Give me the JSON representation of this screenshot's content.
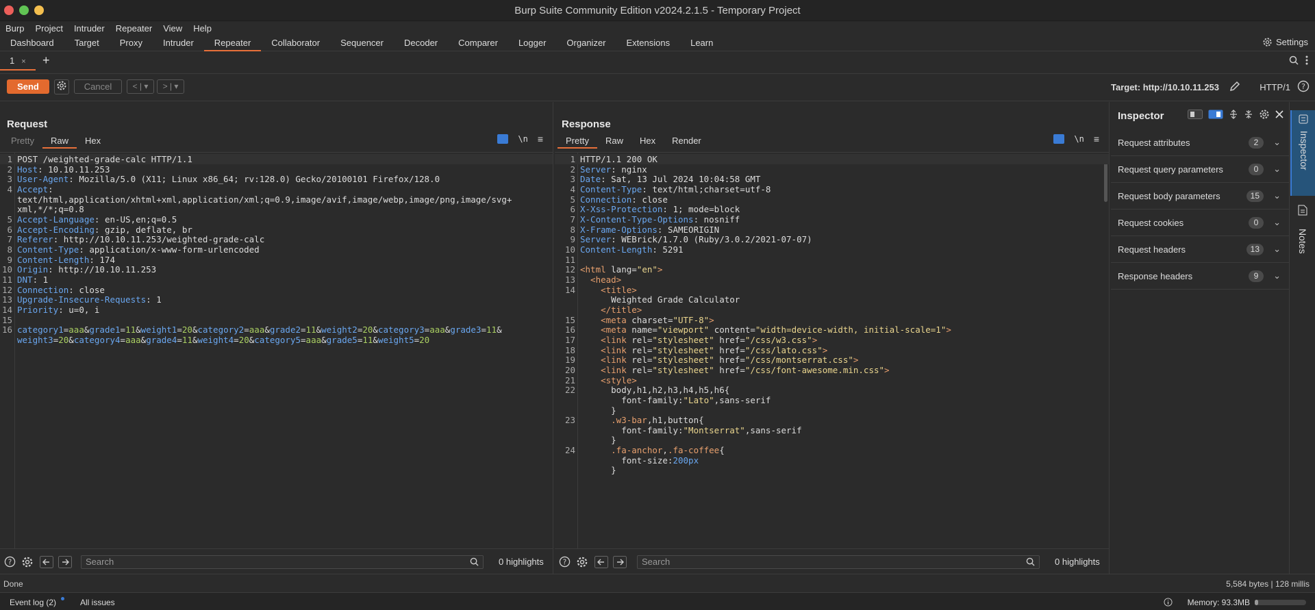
{
  "window": {
    "title": "Burp Suite Community Edition v2024.2.1.5 - Temporary Project"
  },
  "menu": [
    "Burp",
    "Project",
    "Intruder",
    "Repeater",
    "View",
    "Help"
  ],
  "nav_tabs": [
    "Dashboard",
    "Target",
    "Proxy",
    "Intruder",
    "Repeater",
    "Collaborator",
    "Sequencer",
    "Decoder",
    "Comparer",
    "Logger",
    "Organizer",
    "Extensions",
    "Learn"
  ],
  "nav_active": "Repeater",
  "settings_label": "Settings",
  "repeater_tab": {
    "label": "1",
    "close": "×",
    "plus": "+"
  },
  "toolbar": {
    "send": "Send",
    "cancel": "Cancel",
    "prev": "<",
    "next": ">",
    "dropdown": "▾",
    "target": "Target: http://10.10.11.253",
    "http": "HTTP/1"
  },
  "request": {
    "title": "Request",
    "tabs": [
      "Pretty",
      "Raw",
      "Hex"
    ],
    "active_tab": "Raw",
    "lines": [
      {
        "n": "1",
        "parts": [
          [
            "",
            "POST /weighted-grade-calc HTTP/1.1"
          ]
        ]
      },
      {
        "n": "2",
        "parts": [
          [
            "k",
            "Host"
          ],
          [
            "",
            ": 10.10.11.253"
          ]
        ]
      },
      {
        "n": "3",
        "parts": [
          [
            "k",
            "User-Agent"
          ],
          [
            "",
            ": Mozilla/5.0 (X11; Linux x86_64; rv:128.0) Gecko/20100101 Firefox/128.0"
          ]
        ]
      },
      {
        "n": "4",
        "parts": [
          [
            "k",
            "Accept"
          ],
          [
            "",
            ":"
          ]
        ]
      },
      {
        "n": "",
        "parts": [
          [
            "",
            "text/html,application/xhtml+xml,application/xml;q=0.9,image/avif,image/webp,image/png,image/svg+"
          ]
        ]
      },
      {
        "n": "",
        "parts": [
          [
            "",
            "xml,*/*;q=0.8"
          ]
        ]
      },
      {
        "n": "5",
        "parts": [
          [
            "k",
            "Accept-Language"
          ],
          [
            "",
            ": en-US,en;q=0.5"
          ]
        ]
      },
      {
        "n": "6",
        "parts": [
          [
            "k",
            "Accept-Encoding"
          ],
          [
            "",
            ": gzip, deflate, br"
          ]
        ]
      },
      {
        "n": "7",
        "parts": [
          [
            "k",
            "Referer"
          ],
          [
            "",
            ": http://10.10.11.253/weighted-grade-calc"
          ]
        ]
      },
      {
        "n": "8",
        "parts": [
          [
            "k",
            "Content-Type"
          ],
          [
            "",
            ": application/x-www-form-urlencoded"
          ]
        ]
      },
      {
        "n": "9",
        "parts": [
          [
            "k",
            "Content-Length"
          ],
          [
            "",
            ": 174"
          ]
        ]
      },
      {
        "n": "10",
        "parts": [
          [
            "k",
            "Origin"
          ],
          [
            "",
            ": http://10.10.11.253"
          ]
        ]
      },
      {
        "n": "11",
        "parts": [
          [
            "k",
            "DNT"
          ],
          [
            "",
            ": 1"
          ]
        ]
      },
      {
        "n": "12",
        "parts": [
          [
            "k",
            "Connection"
          ],
          [
            "",
            ": close"
          ]
        ]
      },
      {
        "n": "13",
        "parts": [
          [
            "k",
            "Upgrade-Insecure-Requests"
          ],
          [
            "",
            ": 1"
          ]
        ]
      },
      {
        "n": "14",
        "parts": [
          [
            "k",
            "Priority"
          ],
          [
            "",
            ": u=0, i"
          ]
        ]
      },
      {
        "n": "15",
        "parts": [
          [
            "",
            ""
          ]
        ]
      },
      {
        "n": "16",
        "parts": [
          [
            "k",
            "category1"
          ],
          [
            "",
            "="
          ],
          [
            "v",
            "aaa"
          ],
          [
            "",
            "&"
          ],
          [
            "k",
            "grade1"
          ],
          [
            "",
            "="
          ],
          [
            "v",
            "11"
          ],
          [
            "",
            "&"
          ],
          [
            "k",
            "weight1"
          ],
          [
            "",
            "="
          ],
          [
            "v",
            "20"
          ],
          [
            "",
            "&"
          ],
          [
            "k",
            "category2"
          ],
          [
            "",
            "="
          ],
          [
            "v",
            "aaa"
          ],
          [
            "",
            "&"
          ],
          [
            "k",
            "grade2"
          ],
          [
            "",
            "="
          ],
          [
            "v",
            "11"
          ],
          [
            "",
            "&"
          ],
          [
            "k",
            "weight2"
          ],
          [
            "",
            "="
          ],
          [
            "v",
            "20"
          ],
          [
            "",
            "&"
          ],
          [
            "k",
            "category3"
          ],
          [
            "",
            "="
          ],
          [
            "v",
            "aaa"
          ],
          [
            "",
            "&"
          ],
          [
            "k",
            "grade3"
          ],
          [
            "",
            "="
          ],
          [
            "v",
            "11"
          ],
          [
            "",
            "&"
          ]
        ]
      },
      {
        "n": "",
        "parts": [
          [
            "k",
            "weight3"
          ],
          [
            "",
            "="
          ],
          [
            "v",
            "20"
          ],
          [
            "",
            "&"
          ],
          [
            "k",
            "category4"
          ],
          [
            "",
            "="
          ],
          [
            "v",
            "aaa"
          ],
          [
            "",
            "&"
          ],
          [
            "k",
            "grade4"
          ],
          [
            "",
            "="
          ],
          [
            "v",
            "11"
          ],
          [
            "",
            "&"
          ],
          [
            "k",
            "weight4"
          ],
          [
            "",
            "="
          ],
          [
            "v",
            "20"
          ],
          [
            "",
            "&"
          ],
          [
            "k",
            "category5"
          ],
          [
            "",
            "="
          ],
          [
            "v",
            "aaa"
          ],
          [
            "",
            "&"
          ],
          [
            "k",
            "grade5"
          ],
          [
            "",
            "="
          ],
          [
            "v",
            "11"
          ],
          [
            "",
            "&"
          ],
          [
            "k",
            "weight5"
          ],
          [
            "",
            "="
          ],
          [
            "v",
            "20"
          ]
        ]
      }
    ]
  },
  "response": {
    "title": "Response",
    "tabs": [
      "Pretty",
      "Raw",
      "Hex",
      "Render"
    ],
    "active_tab": "Pretty",
    "lines": [
      {
        "n": "1",
        "parts": [
          [
            "",
            "HTTP/1.1 200 OK"
          ]
        ]
      },
      {
        "n": "2",
        "parts": [
          [
            "k",
            "Server"
          ],
          [
            "",
            ": nginx"
          ]
        ]
      },
      {
        "n": "3",
        "parts": [
          [
            "k",
            "Date"
          ],
          [
            "",
            ": Sat, 13 Jul 2024 10:04:58 GMT"
          ]
        ]
      },
      {
        "n": "4",
        "parts": [
          [
            "k",
            "Content-Type"
          ],
          [
            "",
            ": text/html;charset=utf-8"
          ]
        ]
      },
      {
        "n": "5",
        "parts": [
          [
            "k",
            "Connection"
          ],
          [
            "",
            ": close"
          ]
        ]
      },
      {
        "n": "6",
        "parts": [
          [
            "k",
            "X-Xss-Protection"
          ],
          [
            "",
            ": 1; mode=block"
          ]
        ]
      },
      {
        "n": "7",
        "parts": [
          [
            "k",
            "X-Content-Type-Options"
          ],
          [
            "",
            ": nosniff"
          ]
        ]
      },
      {
        "n": "8",
        "parts": [
          [
            "k",
            "X-Frame-Options"
          ],
          [
            "",
            ": SAMEORIGIN"
          ]
        ]
      },
      {
        "n": "9",
        "parts": [
          [
            "k",
            "Server"
          ],
          [
            "",
            ": WEBrick/1.7.0 (Ruby/3.0.2/2021-07-07)"
          ]
        ]
      },
      {
        "n": "10",
        "parts": [
          [
            "k",
            "Content-Length"
          ],
          [
            "",
            ": 5291"
          ]
        ]
      },
      {
        "n": "11",
        "parts": [
          [
            "",
            ""
          ]
        ]
      },
      {
        "n": "12",
        "parts": [
          [
            "t",
            "<html "
          ],
          [
            "",
            "lang"
          ],
          [
            "",
            "="
          ],
          [
            "s",
            "\"en\""
          ],
          [
            "t",
            ">"
          ]
        ]
      },
      {
        "n": "13",
        "parts": [
          [
            "t",
            "  <head>"
          ]
        ]
      },
      {
        "n": "14",
        "parts": [
          [
            "t",
            "    <title>"
          ]
        ]
      },
      {
        "n": "",
        "parts": [
          [
            "",
            "      Weighted Grade Calculator"
          ]
        ]
      },
      {
        "n": "",
        "parts": [
          [
            "t",
            "    </title>"
          ]
        ]
      },
      {
        "n": "15",
        "parts": [
          [
            "t",
            "    <meta "
          ],
          [
            "",
            "charset="
          ],
          [
            "s",
            "\"UTF-8\""
          ],
          [
            "t",
            ">"
          ]
        ]
      },
      {
        "n": "16",
        "parts": [
          [
            "t",
            "    <meta "
          ],
          [
            "",
            "name="
          ],
          [
            "s",
            "\"viewport\""
          ],
          [
            "",
            " content="
          ],
          [
            "s",
            "\"width=device-width, initial-scale=1\""
          ],
          [
            "t",
            ">"
          ]
        ]
      },
      {
        "n": "17",
        "parts": [
          [
            "t",
            "    <link "
          ],
          [
            "",
            "rel="
          ],
          [
            "s",
            "\"stylesheet\""
          ],
          [
            "",
            " href="
          ],
          [
            "s",
            "\"/css/w3.css\""
          ],
          [
            "t",
            ">"
          ]
        ]
      },
      {
        "n": "18",
        "parts": [
          [
            "t",
            "    <link "
          ],
          [
            "",
            "rel="
          ],
          [
            "s",
            "\"stylesheet\""
          ],
          [
            "",
            " href="
          ],
          [
            "s",
            "\"/css/lato.css\""
          ],
          [
            "t",
            ">"
          ]
        ]
      },
      {
        "n": "19",
        "parts": [
          [
            "t",
            "    <link "
          ],
          [
            "",
            "rel="
          ],
          [
            "s",
            "\"stylesheet\""
          ],
          [
            "",
            " href="
          ],
          [
            "s",
            "\"/css/montserrat.css\""
          ],
          [
            "t",
            ">"
          ]
        ]
      },
      {
        "n": "20",
        "parts": [
          [
            "t",
            "    <link "
          ],
          [
            "",
            "rel="
          ],
          [
            "s",
            "\"stylesheet\""
          ],
          [
            "",
            " href="
          ],
          [
            "s",
            "\"/css/font-awesome.min.css\""
          ],
          [
            "t",
            ">"
          ]
        ]
      },
      {
        "n": "21",
        "parts": [
          [
            "t",
            "    <style>"
          ]
        ]
      },
      {
        "n": "22",
        "parts": [
          [
            "",
            "      body,h1,h2,h3,h4,h5,h6{"
          ]
        ]
      },
      {
        "n": "",
        "parts": [
          [
            "",
            "        font-family:"
          ],
          [
            "s",
            "\"Lato\""
          ],
          [
            "",
            ",sans-serif"
          ]
        ]
      },
      {
        "n": "",
        "parts": [
          [
            "",
            "      }"
          ]
        ]
      },
      {
        "n": "23",
        "parts": [
          [
            "a",
            "      .w3-bar"
          ],
          [
            "",
            ",h1,button{"
          ]
        ]
      },
      {
        "n": "",
        "parts": [
          [
            "",
            "        font-family:"
          ],
          [
            "s",
            "\"Montserrat\""
          ],
          [
            "",
            ",sans-serif"
          ]
        ]
      },
      {
        "n": "",
        "parts": [
          [
            "",
            "      }"
          ]
        ]
      },
      {
        "n": "24",
        "parts": [
          [
            "a",
            "      .fa-anchor"
          ],
          [
            "",
            ","
          ],
          [
            "a",
            ".fa-coffee"
          ],
          [
            "",
            "{"
          ]
        ]
      },
      {
        "n": "",
        "parts": [
          [
            "",
            "        font-size:"
          ],
          [
            "n",
            "200px"
          ]
        ]
      },
      {
        "n": "",
        "parts": [
          [
            "",
            "      }"
          ]
        ]
      }
    ]
  },
  "search": {
    "placeholder": "Search",
    "highlights": "0 highlights"
  },
  "inspector": {
    "title": "Inspector",
    "sections": [
      {
        "label": "Request attributes",
        "count": "2"
      },
      {
        "label": "Request query parameters",
        "count": "0"
      },
      {
        "label": "Request body parameters",
        "count": "15"
      },
      {
        "label": "Request cookies",
        "count": "0"
      },
      {
        "label": "Request headers",
        "count": "13"
      },
      {
        "label": "Response headers",
        "count": "9"
      }
    ]
  },
  "rail": {
    "inspector": "Inspector",
    "notes": "Notes"
  },
  "status": {
    "left": "Done",
    "right": "5,584 bytes | 128 millis"
  },
  "bottom": {
    "event_log": "Event log (2)",
    "all_issues": "All issues",
    "memory": "Memory: 93.3MB",
    "memory_fraction": 0.06
  },
  "colors": {
    "accent": "#e8703a",
    "send": "#e36a2e",
    "blue": "#3a7bd5"
  }
}
